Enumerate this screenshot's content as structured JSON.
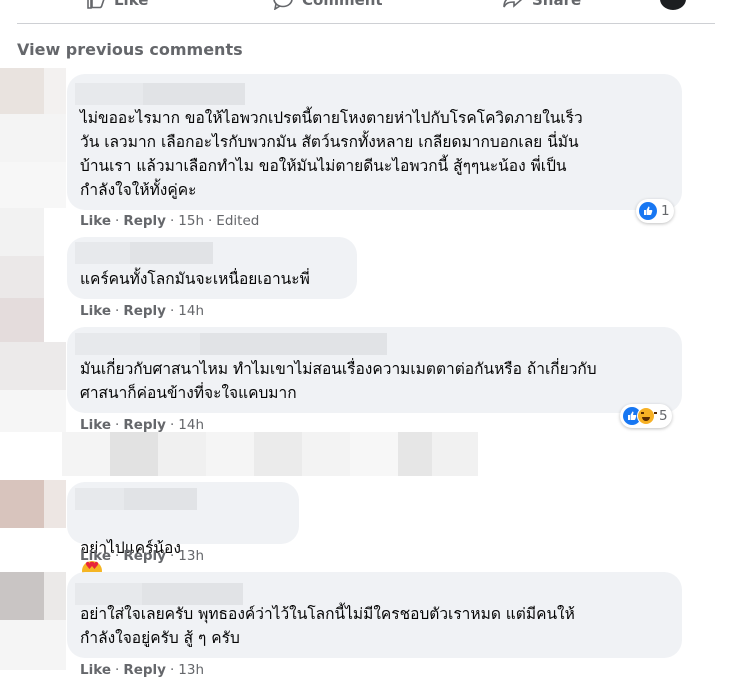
{
  "actions": {
    "like": "Like",
    "comment": "Comment",
    "share": "Share"
  },
  "view_previous": "View previous comments",
  "comments": [
    {
      "text": "ไม่ขออะไรมาก ขอให้ไอพวกเปรตนี้ตายโหงตายห่าไปกับโรคโควิดภายในเร็ว\nวัน เลวมาก เลือกอะไรกับพวกมัน สัตว์นรกทั้งหลาย เกลียดมากบอกเลย นี่มัน\nบ้านเรา แล้วมาเลือกทำไม ขอให้มันไม่ตายดีนะไอพวกนี้ สู้ๆๆนะน้อง พี่เป็น\nกำลังใจให้ทั้งคู่คะ",
      "like": "Like",
      "reply": "Reply",
      "time": "15h",
      "edited": "Edited",
      "reaction_count": "1"
    },
    {
      "text": "แคร์คนทั้งโลกมันจะเหนื่อยเอานะพี่",
      "like": "Like",
      "reply": "Reply",
      "time": "14h"
    },
    {
      "text": "มันเกี่ยวกับศาสนาไหม ทำไมเขาไม่สอนเรื่องความเมตตาต่อกันหรือ ถ้าเกี่ยวกับ\nศาสนาก็ค่อนข้างที่จะใจแคบมาก",
      "like": "Like",
      "reply": "Reply",
      "time": "14h",
      "reaction_count": "5"
    },
    {
      "text": "อย่าไปแคร์น้อง",
      "like": "Like",
      "reply": "Reply",
      "time": "13h"
    },
    {
      "text": "อย่าใส่ใจเลยครับ พุทธองค์ว่าไว้ในโลกนี้ไม่มีใครชอบตัวเราหมด แต่มีคนให้\nกำลังใจอยู่ครับ สู้ ๆ ครับ",
      "like": "Like",
      "reply": "Reply",
      "time": "13h"
    }
  ],
  "colors": {
    "bubble": "#f0f2f5",
    "meta": "#65676b",
    "like_blue": "#1877f2"
  }
}
